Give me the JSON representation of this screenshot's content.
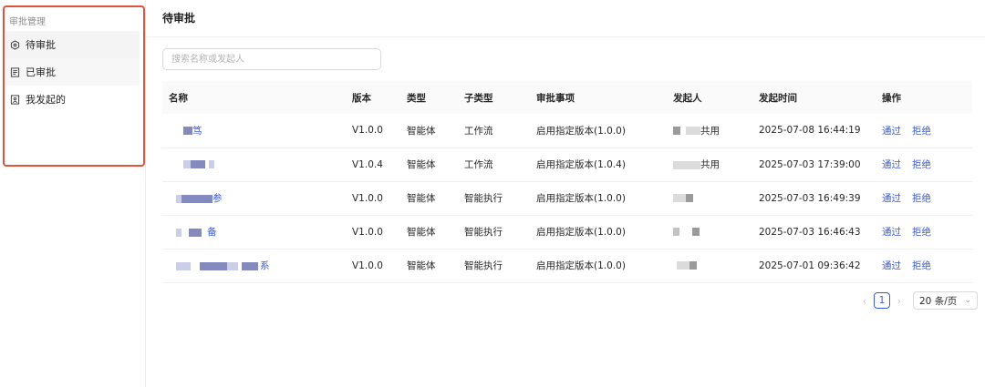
{
  "sidebar": {
    "group_title": "审批管理",
    "items": [
      {
        "label": "待审批",
        "icon": "pending-icon"
      },
      {
        "label": "已审批",
        "icon": "document-icon"
      },
      {
        "label": "我发起的",
        "icon": "file-user-icon"
      }
    ]
  },
  "header": {
    "title": "待审批"
  },
  "search": {
    "placeholder": "搜索名称或发起人"
  },
  "table": {
    "columns": [
      "名称",
      "版本",
      "类型",
      "子类型",
      "审批事项",
      "发起人",
      "发起时间",
      "操作"
    ],
    "rows": [
      {
        "name_tail": "笃",
        "version": "V1.0.0",
        "type": "智能体",
        "subtype": "工作流",
        "item": "启用指定版本(1.0.0)",
        "initiator_tail": "共用",
        "time": "2025-07-08 16:44:19"
      },
      {
        "name_tail": "",
        "version": "V1.0.4",
        "type": "智能体",
        "subtype": "工作流",
        "item": "启用指定版本(1.0.4)",
        "initiator_tail": "共用",
        "time": "2025-07-03 17:39:00"
      },
      {
        "name_tail": "参",
        "version": "V1.0.0",
        "type": "智能体",
        "subtype": "智能执行",
        "item": "启用指定版本(1.0.0)",
        "initiator_tail": "",
        "time": "2025-07-03 16:49:39"
      },
      {
        "name_tail": "备",
        "version": "V1.0.0",
        "type": "智能体",
        "subtype": "智能执行",
        "item": "启用指定版本(1.0.0)",
        "initiator_tail": "",
        "time": "2025-07-03 16:46:43"
      },
      {
        "name_tail": "系",
        "version": "V1.0.0",
        "type": "智能体",
        "subtype": "智能执行",
        "item": "启用指定版本(1.0.0)",
        "initiator_tail": "",
        "time": "2025-07-01 09:36:42"
      }
    ],
    "actions": {
      "approve": "通过",
      "reject": "拒绝"
    }
  },
  "pagination": {
    "current_page": "1",
    "page_size": "20 条/页"
  },
  "colors": {
    "accent": "#3b5bdb",
    "highlight_frame": "#e0533c"
  }
}
